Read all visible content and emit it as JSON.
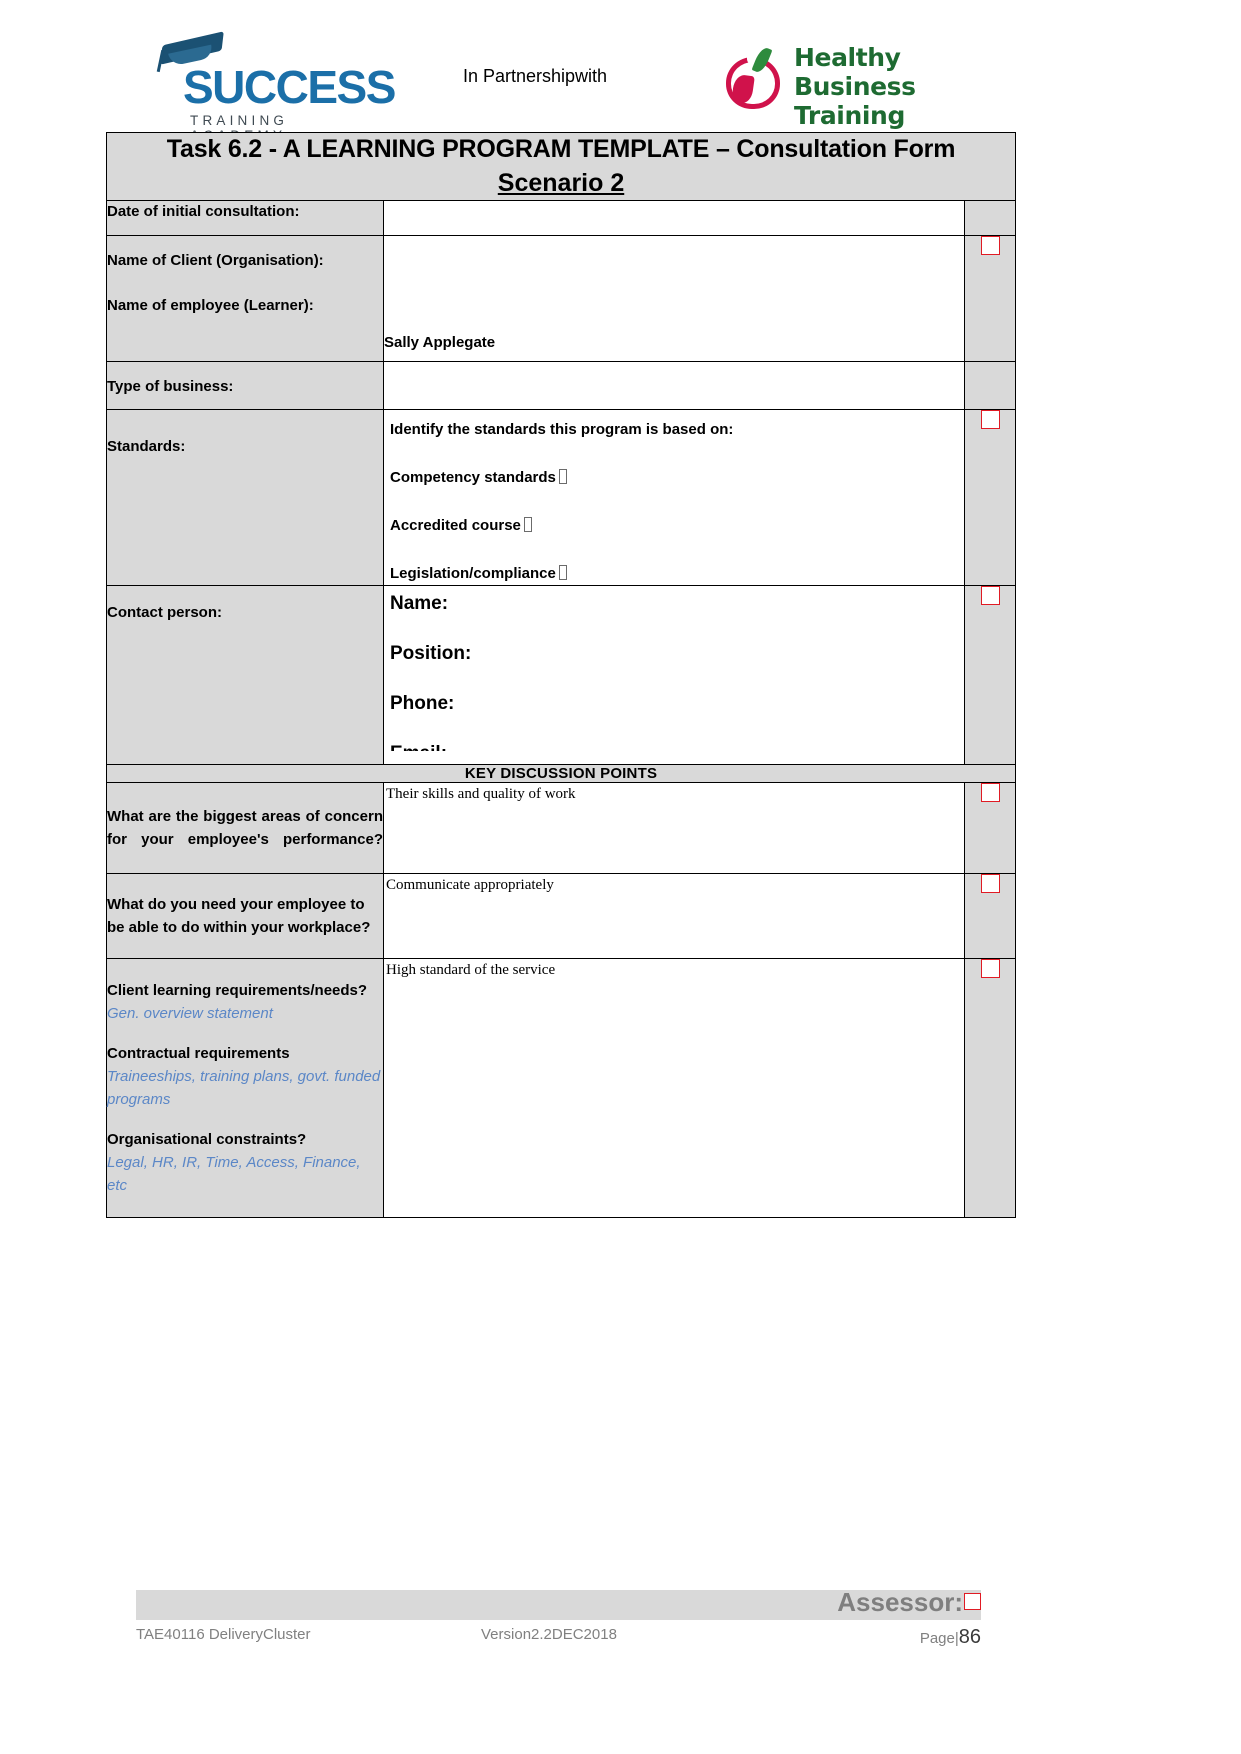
{
  "header": {
    "left_logo": {
      "word": "SUCCESS",
      "tagline": "TRAINING ACADEMY",
      "icon": "graduation-cap-icon",
      "color": "#1b6fa8"
    },
    "partnership_text": "In Partnershipwith",
    "right_logo": {
      "line1": "Healthy Business",
      "line2": "Training Academy",
      "icon": "apple-icon",
      "text_color": "#1e6b32",
      "apple_color": "#d0124b",
      "leaf_color": "#2e8b3d"
    }
  },
  "form": {
    "title_line1": "Task 6.2 - A LEARNING PROGRAM TEMPLATE – Consultation Form",
    "title_line2": "Scenario 2",
    "rows": {
      "date": {
        "label": "Date of initial consultation:",
        "value": ""
      },
      "client": {
        "label1": "Name of Client (Organisation):",
        "label2": "Name of employee (Learner):",
        "value": "Sally Applegate"
      },
      "business": {
        "label": "Type of business:",
        "value": ""
      },
      "standards": {
        "label": "Standards:",
        "prompt": "Identify the standards this program is based on:",
        "options": [
          "Competency standards",
          "Accredited course",
          "Legislation/compliance"
        ]
      },
      "contact": {
        "label": "Contact person:",
        "fields": [
          "Name:",
          "Position:",
          "Phone:",
          "Email:"
        ]
      },
      "kdp_header": "KEY DISCUSSION POINTS",
      "q1": {
        "label": "What are the biggest areas of concern for your employee's performance?",
        "answer": "Their skills and quality of work"
      },
      "q2": {
        "label": "What do you need your employee to be able to do within your workplace?",
        "answer": "Communicate appropriately"
      },
      "q3": {
        "label_a": "Client learning requirements/needs?",
        "hint_a": "Gen. overview statement",
        "label_b": "Contractual requirements",
        "hint_b": "Traineeships, training plans, govt. funded programs",
        "label_c": "Organisational constraints?",
        "hint_c": "Legal, HR, IR, Time, Access, Finance, etc",
        "answer": "High standard of the service"
      }
    },
    "checkbox_color": "#e01b24",
    "hint_color": "#5b87c7",
    "label_bg": "#d9d9d9"
  },
  "footer": {
    "assessor_label": "Assessor:",
    "doc_code": "TAE40116 DeliveryCluster",
    "version": "Version2.2DEC2018",
    "page_label": "Page|",
    "page_number": "86"
  }
}
